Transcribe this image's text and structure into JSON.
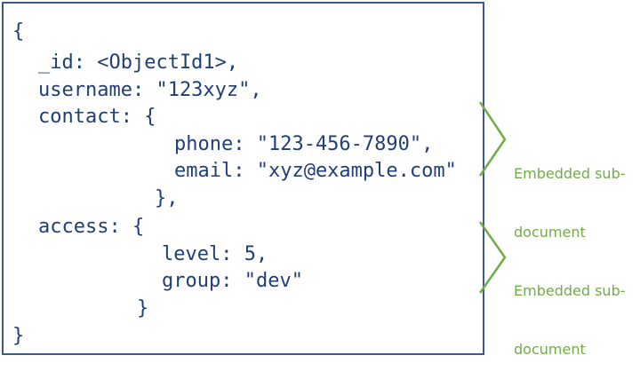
{
  "document": {
    "lines": [
      "{",
      "_id: <ObjectId1>,",
      "username: \"123xyz\",",
      "contact: {",
      "phone: \"123-456-7890\",",
      "email: \"xyz@example.com\"",
      "},",
      "access: {",
      "level: 5,",
      "group: \"dev\"",
      "}",
      "}"
    ]
  },
  "annotations": [
    {
      "line1": "Embedded sub-",
      "line2": "document"
    },
    {
      "line1": "Embedded sub-",
      "line2": "document"
    }
  ],
  "colors": {
    "code_text": "#1f3f7a",
    "box_border": "#3f5a8a",
    "annotation": "#70ad47"
  }
}
